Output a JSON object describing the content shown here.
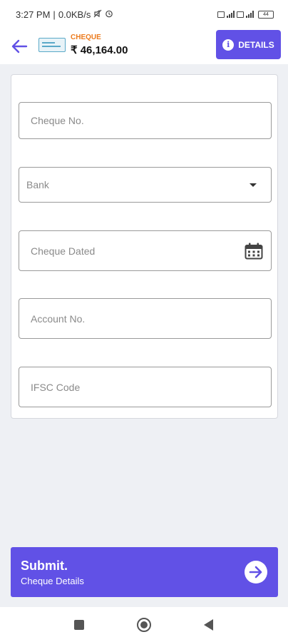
{
  "status_bar": {
    "time": "3:27 PM",
    "speed": "0.0KB/s",
    "separator": "|",
    "battery": "44"
  },
  "header": {
    "payment_mode": "CHEQUE",
    "amount": "₹ 46,164.00",
    "details_label": "DETAILS",
    "accent_color": "#6151e6",
    "mode_color": "#ec7a1c"
  },
  "form": {
    "fields": [
      {
        "label": "Cheque No.",
        "value": ""
      },
      {
        "label": "Bank",
        "value": ""
      },
      {
        "label": "Cheque Dated",
        "value": ""
      },
      {
        "label": "Account No.",
        "value": ""
      },
      {
        "label": "IFSC Code",
        "value": ""
      }
    ]
  },
  "submit": {
    "title": "Submit.",
    "subtitle": "Cheque Details"
  },
  "icons": {
    "back": "arrow-left-icon",
    "info": "info-icon",
    "calendar": "calendar-icon",
    "dropdown": "caret-down-icon",
    "submit": "arrow-right-circle-icon"
  }
}
